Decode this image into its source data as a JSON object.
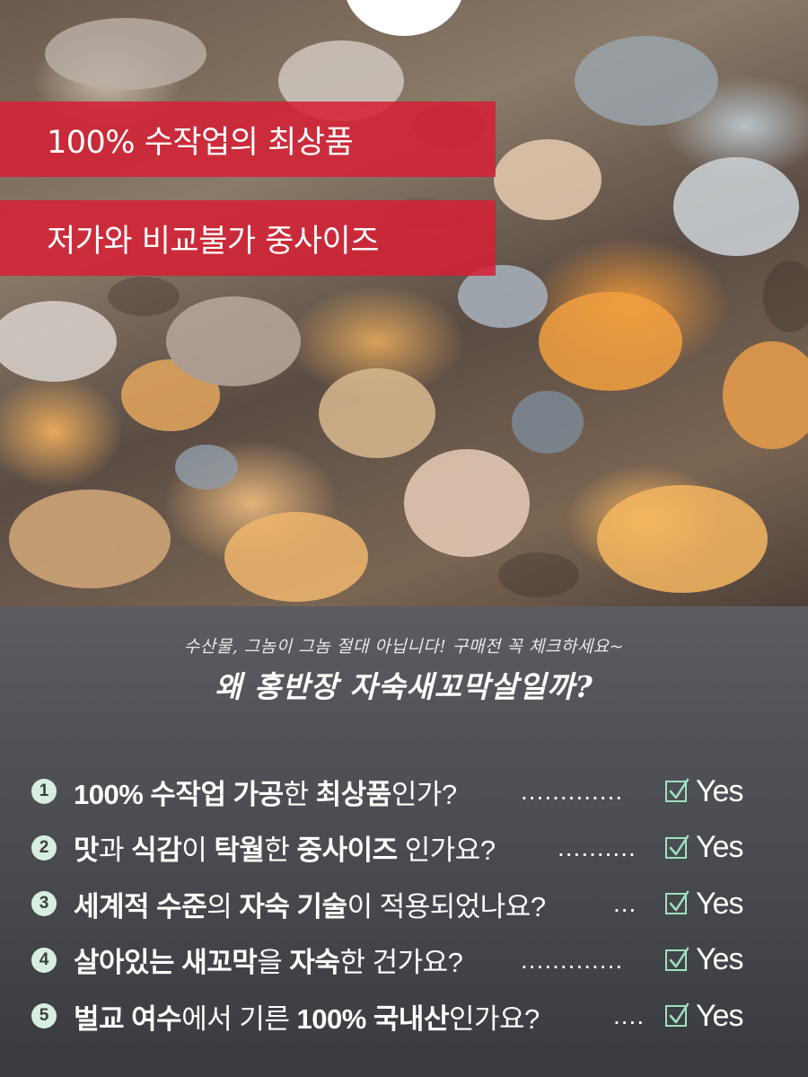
{
  "banners": {
    "line1": "100%  수작업의 최상품",
    "line2": "저가와 비교불가 중사이즈"
  },
  "intro": {
    "subtitle": "수산물, 그놈이 그놈 절대 아닙니다! 구매전 꼭 체크하세요~",
    "title": "왜 홍반장 자숙새꼬막살일까?"
  },
  "checklist": [
    {
      "number": "1",
      "parts": [
        [
          "b",
          "100% 수작업 가공"
        ],
        [
          "n",
          "한 "
        ],
        [
          "b",
          "최상품"
        ],
        [
          "n",
          "인가?"
        ]
      ],
      "dots": ".............",
      "answer": "Yes"
    },
    {
      "number": "2",
      "parts": [
        [
          "b",
          "맛"
        ],
        [
          "n",
          "과 "
        ],
        [
          "b",
          "식감"
        ],
        [
          "n",
          "이 "
        ],
        [
          "b",
          "탁월"
        ],
        [
          "n",
          "한 "
        ],
        [
          "b",
          "중사이즈"
        ],
        [
          "n",
          " 인가요?"
        ]
      ],
      "dots": "..........",
      "answer": "Yes"
    },
    {
      "number": "3",
      "parts": [
        [
          "b",
          "세계적 수준"
        ],
        [
          "n",
          "의 "
        ],
        [
          "b",
          "자숙 기술"
        ],
        [
          "n",
          "이 적용되었나요?"
        ]
      ],
      "dots": "...",
      "answer": "Yes"
    },
    {
      "number": "4",
      "parts": [
        [
          "b",
          "살아있는 새꼬막"
        ],
        [
          "n",
          "을 "
        ],
        [
          "b",
          "자숙"
        ],
        [
          "n",
          "한 건가요?"
        ]
      ],
      "dots": ".............",
      "answer": "Yes"
    },
    {
      "number": "5",
      "parts": [
        [
          "b",
          "벌교 여수"
        ],
        [
          "n",
          "에서 기른 "
        ],
        [
          "b",
          "100% 국내산"
        ],
        [
          "n",
          "인가요?"
        ]
      ],
      "dots": "....",
      "answer": "Yes"
    }
  ],
  "colors": {
    "banner": "#d62034",
    "panel_top": "#5a5c61",
    "panel_bottom": "#3a3b40",
    "number_badge": "#d8efe0",
    "checkmark": "#9fe0c0"
  },
  "icons": {
    "check": "checked-box-icon"
  }
}
